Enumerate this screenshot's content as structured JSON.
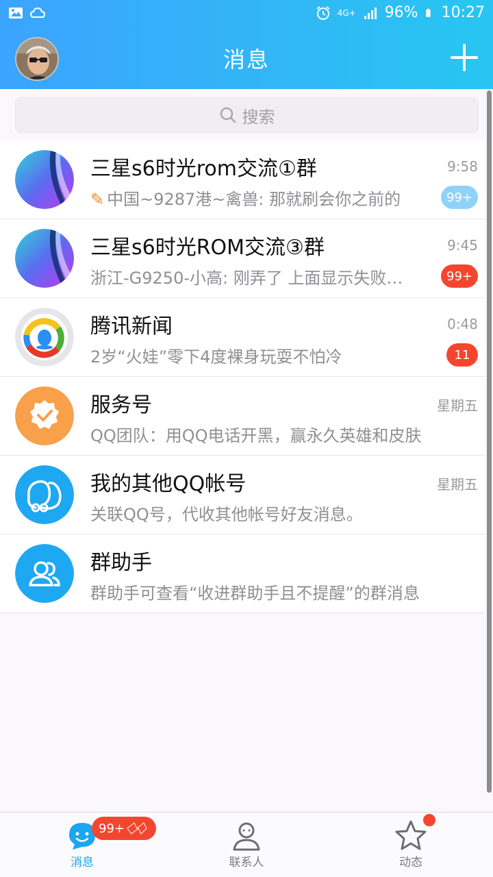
{
  "status_bar": {
    "network": "4G+",
    "battery": "96%",
    "time": "10:27"
  },
  "header": {
    "title": "消息"
  },
  "search": {
    "placeholder": "搜索"
  },
  "conversations": [
    {
      "name": "三星s6时光rom交流①群",
      "time": "9:58",
      "preview": "中国~9287港~禽兽: 那就刷会你之前的",
      "badge": "99+",
      "badge_style": "muted",
      "has_pen": true,
      "icon": "samsung-group-avatar"
    },
    {
      "name": "三星s6时光ROM交流③群",
      "time": "9:45",
      "preview": "浙江-G9250-小高: 刚弄了 上面显示失败…",
      "badge": "99+",
      "badge_style": "red",
      "has_pen": false,
      "icon": "samsung-group-avatar"
    },
    {
      "name": "腾讯新闻",
      "time": "0:48",
      "preview": "2岁“火娃”零下4度裸身玩耍不怕冷",
      "badge": "11",
      "badge_style": "red",
      "has_pen": false,
      "icon": "tencent-news-avatar"
    },
    {
      "name": "服务号",
      "time": "星期五",
      "preview": "QQ团队：用QQ电话开黑，赢永久英雄和皮肤",
      "badge": "",
      "badge_style": "",
      "has_pen": false,
      "icon": "service-badge-avatar"
    },
    {
      "name": "我的其他QQ帐号",
      "time": "星期五",
      "preview": "关联QQ号，代收其他帐号好友消息。",
      "badge": "",
      "badge_style": "",
      "has_pen": false,
      "icon": "linked-accounts-avatar"
    },
    {
      "name": "群助手",
      "time": "",
      "preview": "群助手可查看“收进群助手且不提醒”的群消息",
      "badge": "",
      "badge_style": "",
      "has_pen": false,
      "icon": "group-assistant-avatar"
    }
  ],
  "tabbar": {
    "messages": "消息",
    "messages_badge": "99+",
    "contacts": "联系人",
    "moments": "动态"
  },
  "colors": {
    "header_start": "#3ba4ff",
    "header_end": "#27c6f2",
    "badge_red": "#f4462f",
    "badge_muted": "#8fd2f7",
    "active_tab": "#1aa6f0"
  }
}
